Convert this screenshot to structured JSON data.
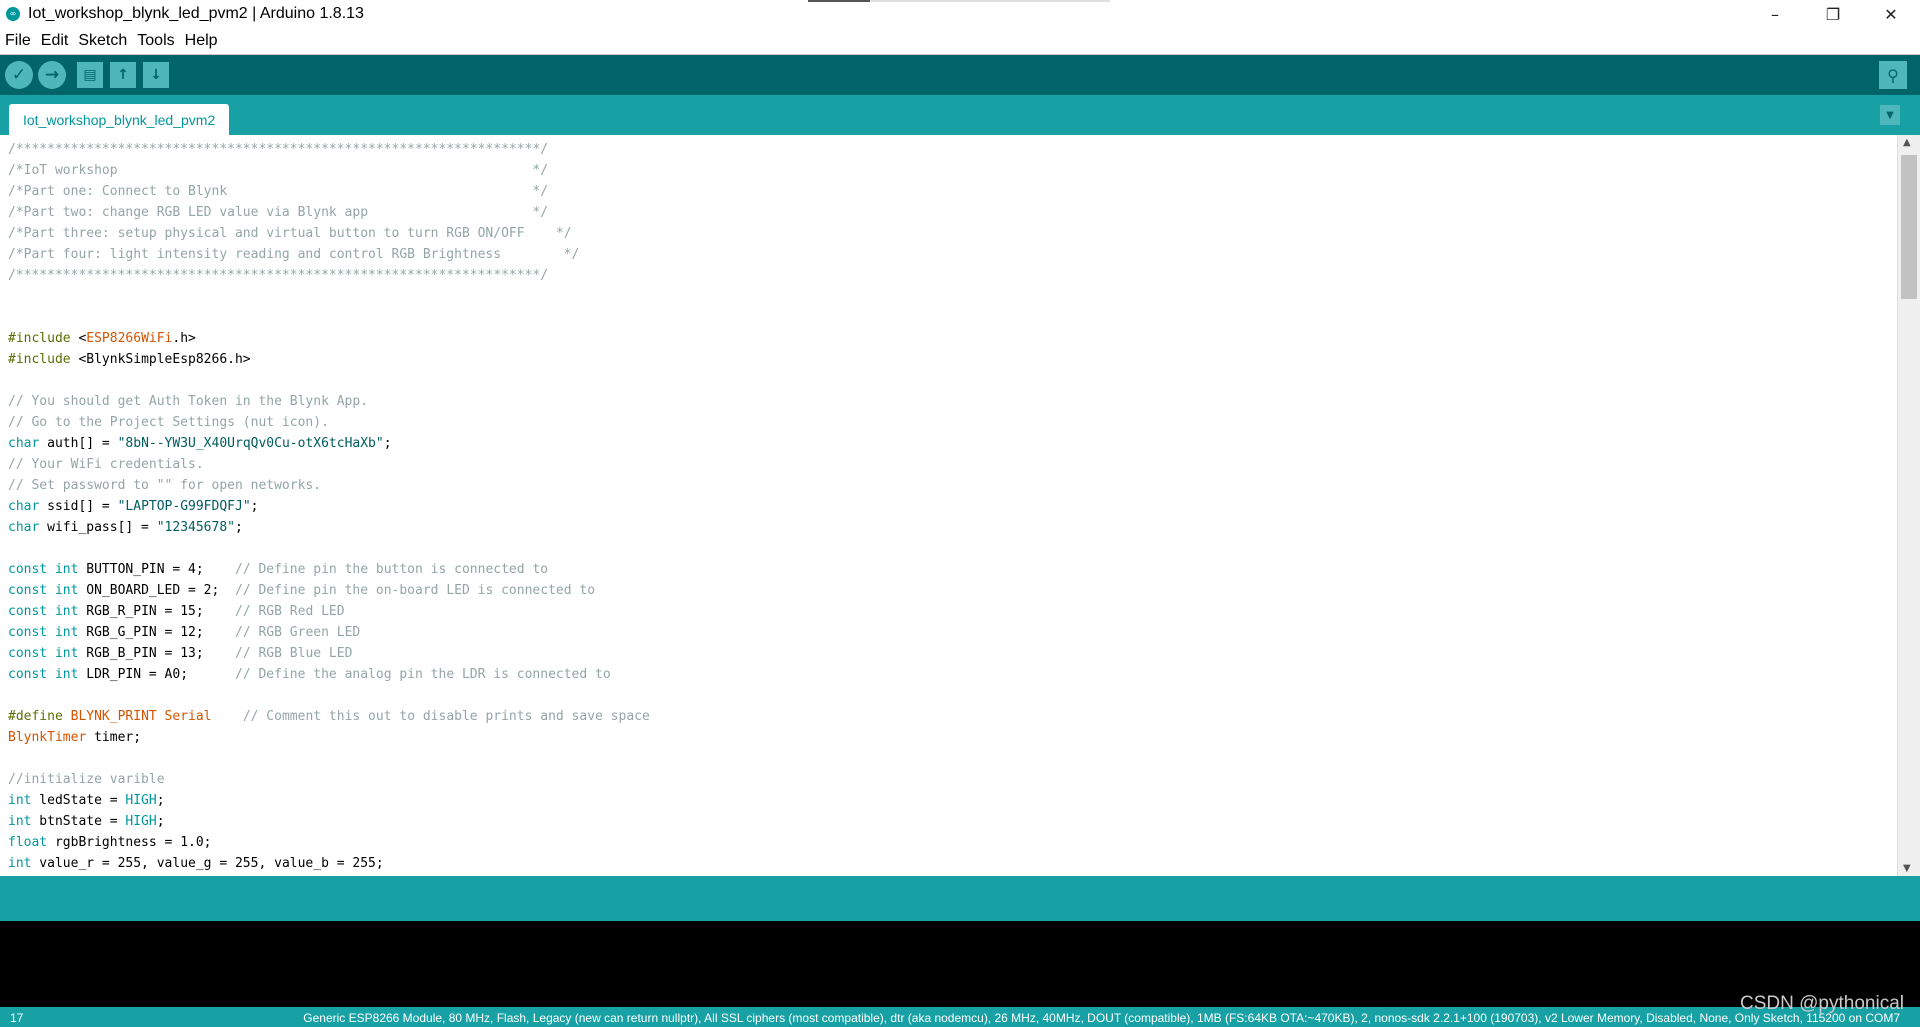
{
  "window": {
    "title": "Iot_workshop_blynk_led_pvm2 | Arduino 1.8.13",
    "minimize": "–",
    "restore": "❐",
    "close": "✕"
  },
  "menu": {
    "items": [
      "File",
      "Edit",
      "Sketch",
      "Tools",
      "Help"
    ]
  },
  "toolbar": {
    "verify_icon": "✓",
    "upload_icon": "→",
    "new_icon": "🗋",
    "open_icon": "↑",
    "save_icon": "↓",
    "serial_monitor_icon": "⚲"
  },
  "tabs": {
    "active": "Iot_workshop_blynk_led_pvm2",
    "menu_icon": "▼"
  },
  "editor": {
    "lines": [
      [
        {
          "t": "/*******************************************************************/",
          "c": "com"
        }
      ],
      [
        {
          "t": "/*IoT workshop                                                     */",
          "c": "com"
        }
      ],
      [
        {
          "t": "/*Part one: Connect to Blynk                                       */",
          "c": "com"
        }
      ],
      [
        {
          "t": "/*Part two: change RGB LED value via Blynk app                     */",
          "c": "com"
        }
      ],
      [
        {
          "t": "/*Part three: setup physical and virtual button to turn RGB ON/OFF    */",
          "c": "com"
        }
      ],
      [
        {
          "t": "/*Part four: light intensity reading and control RGB Brightness        */",
          "c": "com"
        }
      ],
      [
        {
          "t": "/*******************************************************************/",
          "c": "com"
        }
      ],
      [
        {
          "t": "",
          "c": "plain"
        }
      ],
      [
        {
          "t": "",
          "c": "plain"
        }
      ],
      [
        {
          "t": "#include",
          "c": "pp"
        },
        {
          "t": " <",
          "c": "plain"
        },
        {
          "t": "ESP8266WiFi",
          "c": "lib"
        },
        {
          "t": ".h>",
          "c": "plain"
        }
      ],
      [
        {
          "t": "#include",
          "c": "pp"
        },
        {
          "t": " <BlynkSimpleEsp8266.h>",
          "c": "plain"
        }
      ],
      [
        {
          "t": "",
          "c": "plain"
        }
      ],
      [
        {
          "t": "// You should get Auth Token in the Blynk App.",
          "c": "com"
        }
      ],
      [
        {
          "t": "// Go to the Project Settings (nut icon).",
          "c": "com"
        }
      ],
      [
        {
          "t": "char",
          "c": "kw"
        },
        {
          "t": " auth[] = ",
          "c": "plain"
        },
        {
          "t": "\"8bN--YW3U_X40UrqQv0Cu-otX6tcHaXb\"",
          "c": "str"
        },
        {
          "t": ";",
          "c": "plain"
        }
      ],
      [
        {
          "t": "// Your WiFi credentials.",
          "c": "com"
        }
      ],
      [
        {
          "t": "// Set password to \"\" for open networks.",
          "c": "com"
        }
      ],
      [
        {
          "t": "char",
          "c": "kw"
        },
        {
          "t": " ssid[] = ",
          "c": "plain"
        },
        {
          "t": "\"LAPTOP-G99FDQFJ\"",
          "c": "str"
        },
        {
          "t": ";",
          "c": "plain"
        }
      ],
      [
        {
          "t": "char",
          "c": "kw"
        },
        {
          "t": " wifi_pass[] = ",
          "c": "plain"
        },
        {
          "t": "\"12345678\"",
          "c": "str"
        },
        {
          "t": ";",
          "c": "plain"
        }
      ],
      [
        {
          "t": "",
          "c": "plain"
        }
      ],
      [
        {
          "t": "const",
          "c": "kw"
        },
        {
          "t": " ",
          "c": "plain"
        },
        {
          "t": "int",
          "c": "kw"
        },
        {
          "t": " BUTTON_PIN = 4;    ",
          "c": "plain"
        },
        {
          "t": "// Define pin the button is connected to",
          "c": "com"
        }
      ],
      [
        {
          "t": "const",
          "c": "kw"
        },
        {
          "t": " ",
          "c": "plain"
        },
        {
          "t": "int",
          "c": "kw"
        },
        {
          "t": " ON_BOARD_LED = 2;  ",
          "c": "plain"
        },
        {
          "t": "// Define pin the on-board LED is connected to",
          "c": "com"
        }
      ],
      [
        {
          "t": "const",
          "c": "kw"
        },
        {
          "t": " ",
          "c": "plain"
        },
        {
          "t": "int",
          "c": "kw"
        },
        {
          "t": " RGB_R_PIN = 15;    ",
          "c": "plain"
        },
        {
          "t": "// RGB Red LED",
          "c": "com"
        }
      ],
      [
        {
          "t": "const",
          "c": "kw"
        },
        {
          "t": " ",
          "c": "plain"
        },
        {
          "t": "int",
          "c": "kw"
        },
        {
          "t": " RGB_G_PIN = 12;    ",
          "c": "plain"
        },
        {
          "t": "// RGB Green LED",
          "c": "com"
        }
      ],
      [
        {
          "t": "const",
          "c": "kw"
        },
        {
          "t": " ",
          "c": "plain"
        },
        {
          "t": "int",
          "c": "kw"
        },
        {
          "t": " RGB_B_PIN = 13;    ",
          "c": "plain"
        },
        {
          "t": "// RGB Blue LED",
          "c": "com"
        }
      ],
      [
        {
          "t": "const",
          "c": "kw"
        },
        {
          "t": " ",
          "c": "plain"
        },
        {
          "t": "int",
          "c": "kw"
        },
        {
          "t": " LDR_PIN = A0;      ",
          "c": "plain"
        },
        {
          "t": "// Define the analog pin the LDR is connected to",
          "c": "com"
        }
      ],
      [
        {
          "t": "",
          "c": "plain"
        }
      ],
      [
        {
          "t": "#define",
          "c": "pp"
        },
        {
          "t": " ",
          "c": "plain"
        },
        {
          "t": "BLYNK_PRINT Serial",
          "c": "lib"
        },
        {
          "t": "    ",
          "c": "plain"
        },
        {
          "t": "// Comment this out to disable prints and save space",
          "c": "com"
        }
      ],
      [
        {
          "t": "BlynkTimer",
          "c": "ty"
        },
        {
          "t": " timer;",
          "c": "plain"
        }
      ],
      [
        {
          "t": "",
          "c": "plain"
        }
      ],
      [
        {
          "t": "//initialize varible",
          "c": "com"
        }
      ],
      [
        {
          "t": "int",
          "c": "kw"
        },
        {
          "t": " ledState = ",
          "c": "plain"
        },
        {
          "t": "HIGH",
          "c": "kw"
        },
        {
          "t": ";",
          "c": "plain"
        }
      ],
      [
        {
          "t": "int",
          "c": "kw"
        },
        {
          "t": " btnState = ",
          "c": "plain"
        },
        {
          "t": "HIGH",
          "c": "kw"
        },
        {
          "t": ";",
          "c": "plain"
        }
      ],
      [
        {
          "t": "float",
          "c": "kw"
        },
        {
          "t": " rgbBrightness = 1.0;",
          "c": "plain"
        }
      ],
      [
        {
          "t": "int",
          "c": "kw"
        },
        {
          "t": " value_r = 255, value_g = 255, value_b = 255;",
          "c": "plain"
        }
      ]
    ]
  },
  "status": {
    "line_number": "17",
    "board_info": "Generic ESP8266 Module, 80 MHz, Flash, Legacy (new can return nullptr), All SSL ciphers (most compatible), dtr (aka nodemcu), 26 MHz, 40MHz, DOUT (compatible), 1MB (FS:64KB OTA:~470KB), 2, nonos-sdk 2.2.1+100 (190703), v2 Lower Memory, Disabled, None, Only Sketch, 115200 on COM7"
  },
  "watermark": "CSDN @pythonical",
  "colors": {
    "toolbar_dark": "#006468",
    "teal": "#17a1a5",
    "keyword": "#00979c",
    "comment": "#95a5a6",
    "string": "#005c5f",
    "preprocessor": "#5e6d03",
    "library": "#d35400"
  }
}
